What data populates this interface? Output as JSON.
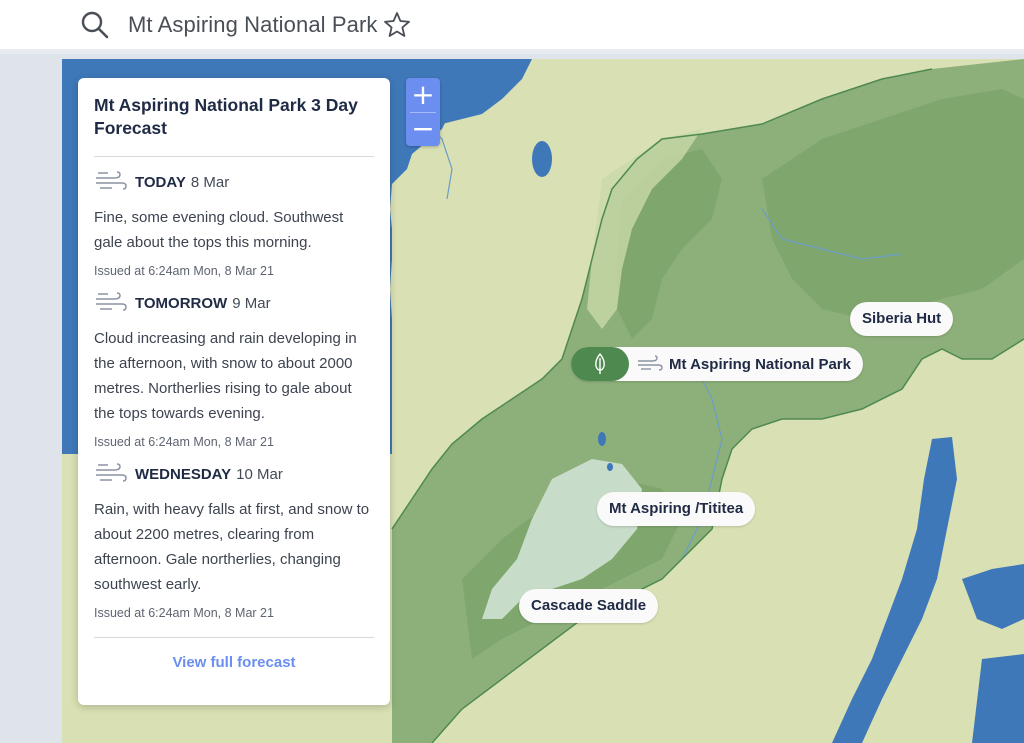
{
  "search": {
    "query": "Mt Aspiring National Park"
  },
  "colors": {
    "water": "#3f78b8",
    "land": "#d9e0b3",
    "park": "#8db07a",
    "accent": "#6b8ef0",
    "pin": "#4e8a4f"
  },
  "zoom": {
    "in_label": "+",
    "out_label": "−"
  },
  "forecast": {
    "title": "Mt Aspiring National Park 3 Day Forecast",
    "days": [
      {
        "name": "TODAY",
        "date": "8 Mar",
        "text": "Fine, some evening cloud. Southwest gale about the tops this morning.",
        "issued": "Issued at 6:24am Mon, 8 Mar 21",
        "icon": "wind-icon"
      },
      {
        "name": "TOMORROW",
        "date": "9 Mar",
        "text": "Cloud increasing and rain developing in the afternoon, with snow to about 2000 metres. Northerlies rising to gale about the tops towards evening.",
        "issued": "Issued at 6:24am Mon, 8 Mar 21",
        "icon": "wind-icon"
      },
      {
        "name": "WEDNESDAY",
        "date": "10 Mar",
        "text": "Rain, with heavy falls at first, and snow to about 2200 metres, clearing from afternoon. Gale northerlies, changing southwest early.",
        "issued": "Issued at 6:24am Mon, 8 Mar 21",
        "icon": "wind-icon"
      }
    ],
    "link_label": "View full forecast"
  },
  "map_labels": {
    "park": "Mt Aspiring National Park",
    "siberia": "Siberia Hut",
    "peak": "Mt Aspiring /Tititea",
    "saddle": "Cascade Saddle"
  }
}
